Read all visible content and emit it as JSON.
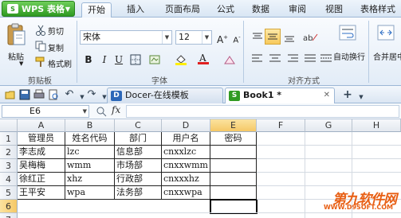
{
  "app": {
    "name": "WPS 表格",
    "logo": "S"
  },
  "ribbon_tabs": [
    "开始",
    "插入",
    "页面布局",
    "公式",
    "数据",
    "审阅",
    "视图",
    "表格样式"
  ],
  "active_tab": "开始",
  "clipboard": {
    "paste": "粘贴",
    "cut": "剪切",
    "copy": "复制",
    "format_painter": "格式刷",
    "group": "剪贴板"
  },
  "font": {
    "name": "宋体",
    "size": "12",
    "group": "字体"
  },
  "alignment": {
    "group": "对齐方式",
    "wrap": "自动换行",
    "merge": "合并居中"
  },
  "doc_tabs": [
    {
      "label": "Docer-在线模板",
      "active": false
    },
    {
      "label": "Book1 *",
      "active": true
    }
  ],
  "formula_bar": {
    "name_box": "E6",
    "fx": "fx",
    "value": ""
  },
  "columns": [
    "A",
    "B",
    "C",
    "D",
    "E",
    "F",
    "G",
    "H"
  ],
  "rows": [
    "1",
    "2",
    "3",
    "4",
    "5",
    "6",
    "7"
  ],
  "table": [
    [
      "管理员",
      "姓名代码",
      "部门",
      "用户名",
      "密码"
    ],
    [
      "李志成",
      "lzc",
      "信息部",
      "cnxxlzc",
      ""
    ],
    [
      "吴梅梅",
      "wmm",
      "市场部",
      "cnxxwmm",
      ""
    ],
    [
      "徐红正",
      "xhz",
      "行政部",
      "cnxxxhz",
      ""
    ],
    [
      "王平安",
      "wpa",
      "法务部",
      "cnxxwpa",
      ""
    ]
  ],
  "active_cell": "E6",
  "watermark": {
    "brand": "第九软件网",
    "url": "WWW.D9SOFT.COM"
  },
  "colors": {
    "accent": "#2f9a22",
    "ribbon": "#dbe6f3",
    "selected_header": "#f5c866"
  }
}
